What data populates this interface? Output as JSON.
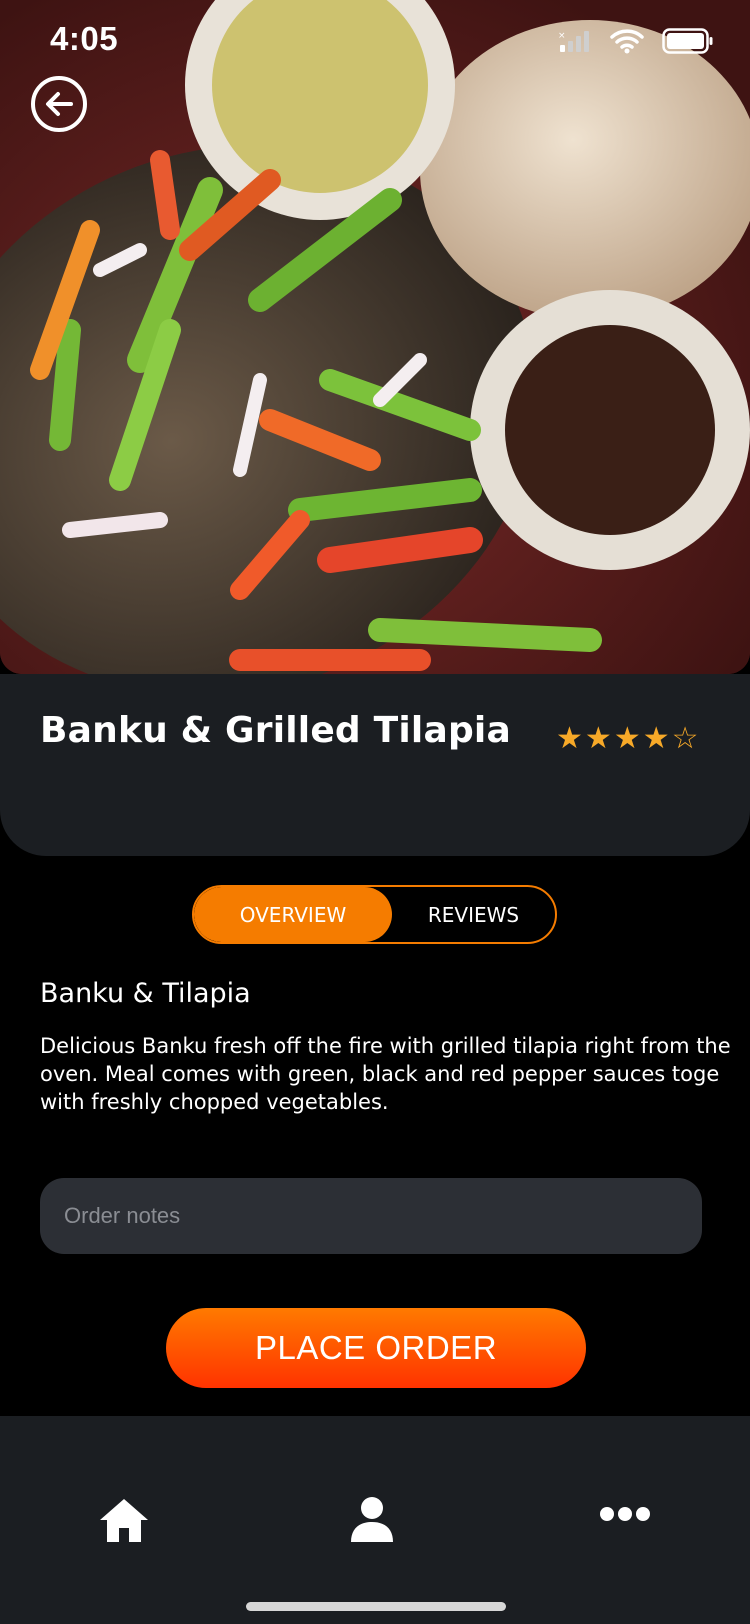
{
  "status_bar": {
    "time": "4:05",
    "icons": [
      "signal-icon",
      "wifi-icon",
      "battery-icon"
    ]
  },
  "header": {
    "back_icon": "back-arrow-icon",
    "hero_image": "banku-grilled-tilapia-photo"
  },
  "dish": {
    "title": "Banku & Grilled Tilapia",
    "rating": 4,
    "rating_max": 5
  },
  "tabs": [
    {
      "label": "OVERVIEW",
      "active": true
    },
    {
      "label": "REVIEWS",
      "active": false
    }
  ],
  "overview": {
    "heading": "Banku & Tilapia",
    "description_lines": [
      "Delicious Banku fresh off the fire with grilled tilapia right from the",
      "oven. Meal comes with green, black and red pepper sauces toge",
      "with freshly chopped vegetables."
    ]
  },
  "order_notes": {
    "placeholder": "Order notes",
    "value": ""
  },
  "actions": {
    "place_order_label": "PLACE ORDER"
  },
  "bottom_nav": {
    "items": [
      {
        "name": "home",
        "icon": "home-icon"
      },
      {
        "name": "profile",
        "icon": "user-icon"
      },
      {
        "name": "more",
        "icon": "more-icon"
      }
    ]
  },
  "colors": {
    "accent": "#f57c00",
    "star": "#f7a928",
    "card_bg": "#1b1e22",
    "input_bg": "#2c2f35",
    "button_gradient_top": "#ff7a00",
    "button_gradient_bottom": "#ff3300"
  }
}
